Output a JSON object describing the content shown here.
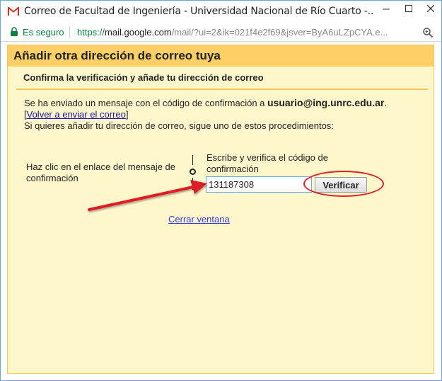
{
  "window": {
    "title": "Correo de Facultad de Ingeniería - Universidad Nacional de Río Cuarto -...",
    "buttons": {
      "minimize": "—",
      "maximize": "☐",
      "close": "✕"
    }
  },
  "address_bar": {
    "secure_label": "Es seguro",
    "url_scheme": "https://",
    "url_host": "mail.google.com",
    "url_rest": "/mail/?ui=2&ik=021f4e2f69&jsver=ByA6uLZpCYA.e..."
  },
  "dialog": {
    "title": "Añadir otra dirección de correo tuya",
    "subheader": "Confirma la verificación y añade tu dirección de correo",
    "info_line1_prefix": "Se ha enviado un mensaje con el código de confirmación a ",
    "email": "usuario@ing.unrc.edu.ar",
    "info_line1_suffix": ".",
    "resend_open": "[",
    "resend_link": "Volver a enviar el correo",
    "resend_close": "]",
    "info_line3": "Si quieres añadir tu dirección de correo, sigue uno de estos procedimientos:",
    "option_left": "Haz clic en el enlace del mensaje de confirmación",
    "option_right_label": "Escribe y verifica el código de confirmación",
    "code_value": "131187308",
    "verify_button": "Verificar",
    "close_link": "Cerrar ventana"
  },
  "colors": {
    "header_bg": "#fcd066",
    "dialog_bg": "#fff7cc",
    "annotation": "#e01f26",
    "secure_green": "#0b8043"
  }
}
